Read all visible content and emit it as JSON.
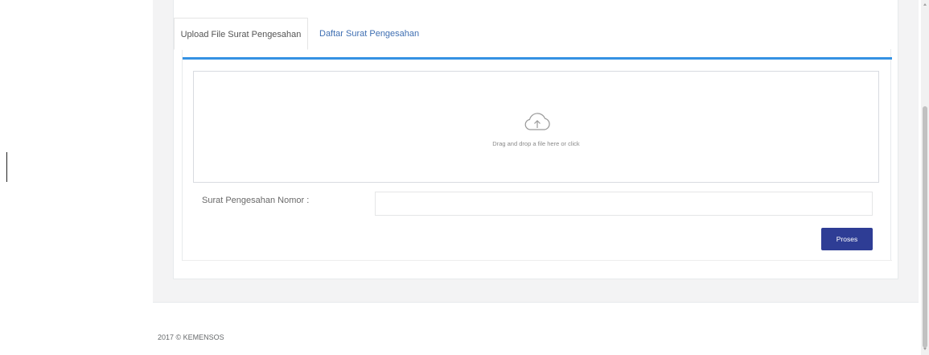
{
  "tabs": [
    {
      "label": "Upload File Surat Pengesahan",
      "active": true
    },
    {
      "label": "Daftar Surat Pengesahan",
      "active": false
    }
  ],
  "upload": {
    "dropzone_text": "Drag and drop a file here or click",
    "icon": "cloud-upload-icon"
  },
  "form": {
    "label": "Surat Pengesahan Nomor :",
    "value": "",
    "placeholder": ""
  },
  "buttons": {
    "submit": "Proses"
  },
  "footer": {
    "text": "2017 © KEMENSOS"
  },
  "colors": {
    "accent": "#3592e3",
    "button": "#2e3d95",
    "tab_link": "#3f6fb2",
    "page_bg": "#f3f3f4"
  }
}
